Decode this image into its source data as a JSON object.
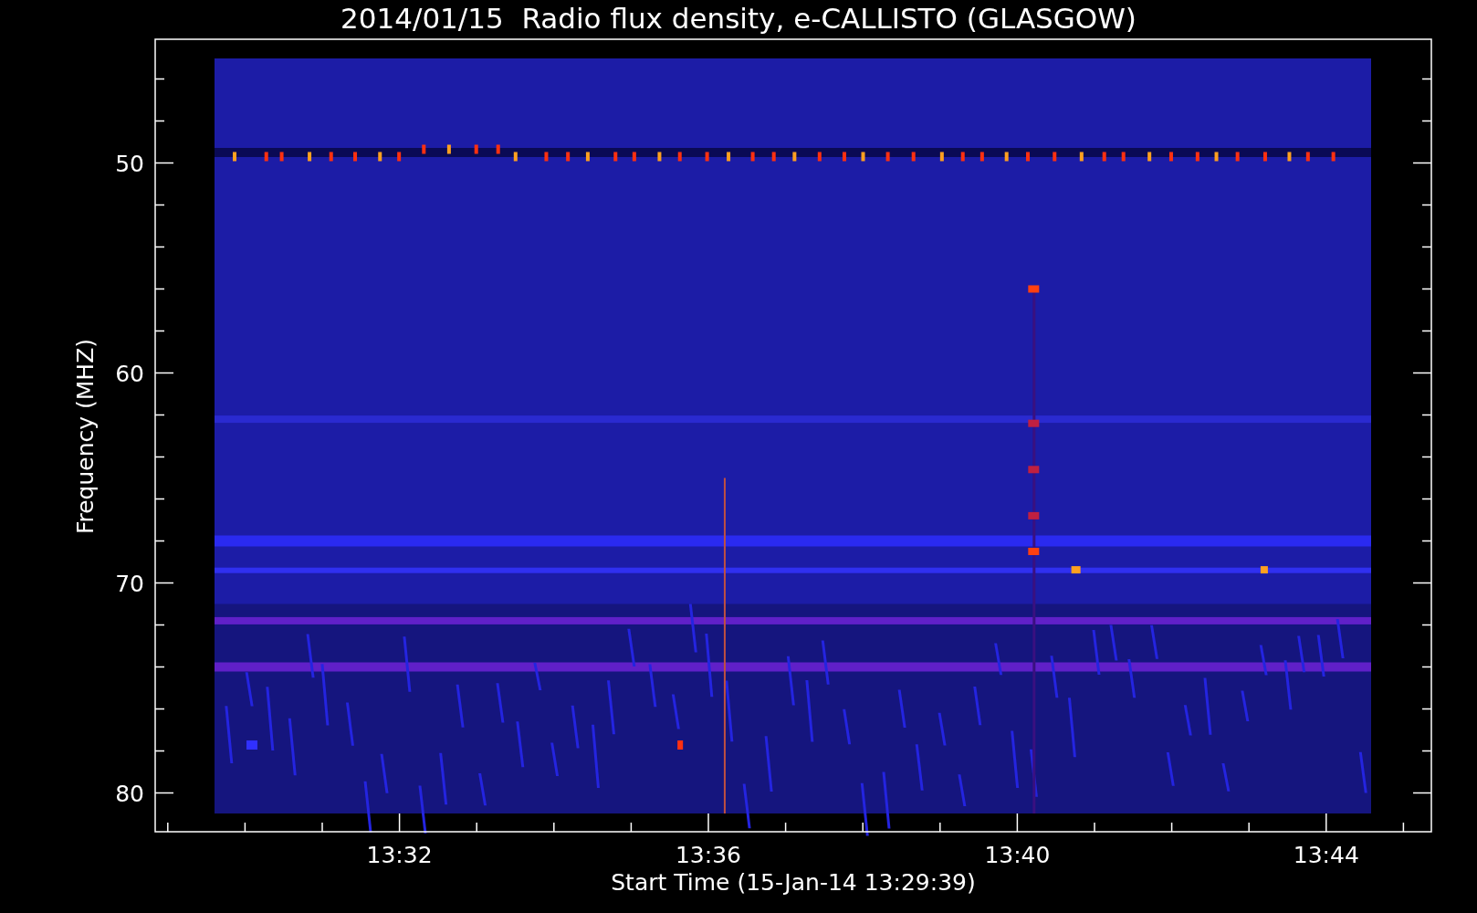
{
  "title": "2014/01/15  Radio flux density, e-CALLISTO (GLASGOW)",
  "y_axis": {
    "label": "Frequency (MHZ)",
    "ticks": [
      "50",
      "60",
      "70",
      "80"
    ]
  },
  "x_axis": {
    "label": "Start Time (15-Jan-14 13:29:39)",
    "ticks": [
      "13:32",
      "13:36",
      "13:40",
      "13:44"
    ]
  }
}
